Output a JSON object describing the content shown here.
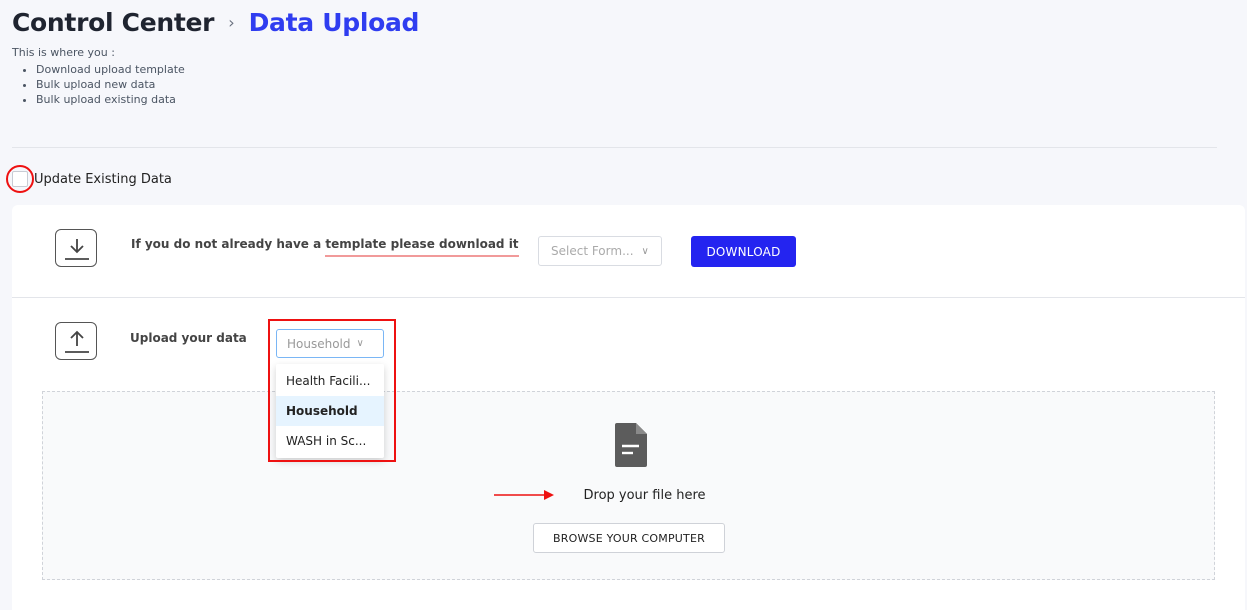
{
  "breadcrumb": {
    "root": "Control Center",
    "separator": "›",
    "current": "Data Upload"
  },
  "intro": {
    "lead": "This is where you :",
    "items": [
      "Download upload template",
      "Bulk upload new data",
      "Bulk upload existing data"
    ]
  },
  "update_existing": {
    "label": "Update Existing Data",
    "checked": false
  },
  "template_row": {
    "text_prefix": "If you do not already have a ",
    "text_link": "template please download it",
    "select_placeholder": "Select Form...",
    "download_label": "DOWNLOAD",
    "icon": "download-icon"
  },
  "upload_row": {
    "label": "Upload your data",
    "icon": "upload-icon",
    "form_select_value": "Household",
    "options": [
      "Health Facili...",
      "Household",
      "WASH in Sc..."
    ],
    "selected_option": "Household"
  },
  "dropzone": {
    "icon": "file-icon",
    "text": "Drop your file here",
    "browse_label": "BROWSE YOUR COMPUTER"
  },
  "colors": {
    "accent": "#2f3df0",
    "button": "#2424f0",
    "annotation": "#ee1111"
  }
}
